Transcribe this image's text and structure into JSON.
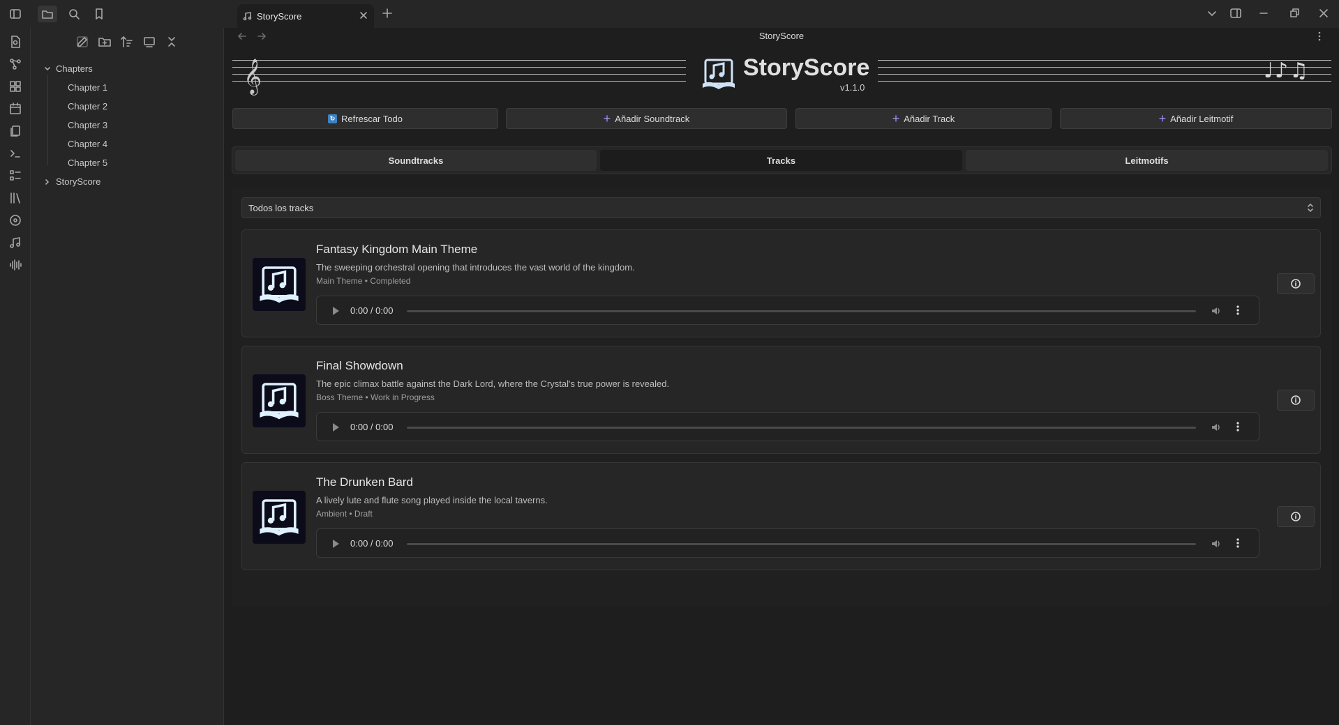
{
  "window": {
    "tab_title": "StoryScore",
    "view_title": "StoryScore"
  },
  "explorer": {
    "root_folder": "Chapters",
    "items": [
      "Chapter 1",
      "Chapter 2",
      "Chapter 3",
      "Chapter 4",
      "Chapter 5"
    ],
    "collapsed_folder": "StoryScore"
  },
  "header": {
    "app_name": "StoryScore",
    "version": "v1.1.0",
    "clef_glyph": "𝄞",
    "notes_glyph": "♩♪♫"
  },
  "actions": {
    "refresh": "Refrescar Todo",
    "add_soundtrack": "Añadir Soundtrack",
    "add_track": "Añadir Track",
    "add_leitmotif": "Añadir Leitmotif"
  },
  "view_tabs": {
    "soundtracks": "Soundtracks",
    "tracks": "Tracks",
    "leitmotifs": "Leitmotifs",
    "active": "Tracks"
  },
  "filter": {
    "selected": "Todos los tracks"
  },
  "tracks": [
    {
      "title": "Fantasy Kingdom Main Theme",
      "description": "The sweeping orchestral opening that introduces the vast world of the kingdom.",
      "meta": "Main Theme • Completed",
      "time": "0:00 / 0:00"
    },
    {
      "title": "Final Showdown",
      "description": "The epic climax battle against the Dark Lord, where the Crystal's true power is revealed.",
      "meta": "Boss Theme • Work in Progress",
      "time": "0:00 / 0:00"
    },
    {
      "title": "The Drunken Bard",
      "description": "A lively lute and flute song played inside the local taverns.",
      "meta": "Ambient • Draft",
      "time": "0:00 / 0:00"
    }
  ],
  "colors": {
    "accent_plus": "#a78bfa",
    "refresh_icon": "#3b82c4",
    "cover_bg": "#0b0b1a"
  }
}
